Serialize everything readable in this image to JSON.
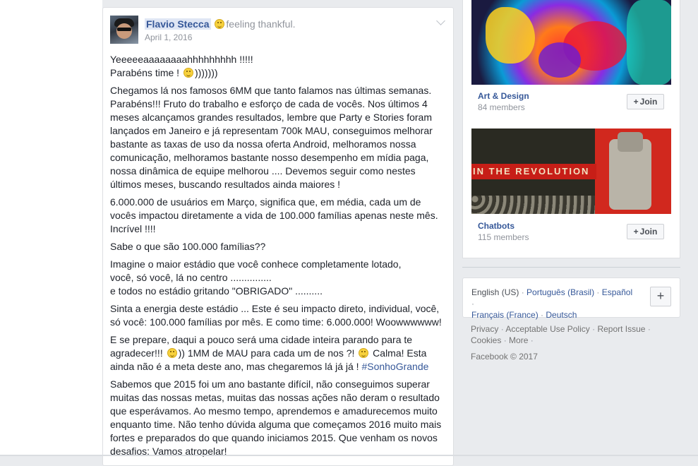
{
  "post": {
    "author": "Flavio Stecca",
    "feeling": "feeling thankful.",
    "date": "April 1, 2016",
    "paragraphs": [
      "Yeeeeeaaaaaaaahhhhhhhhh !!!!!",
      "Chegamos lá nos famosos 6MM que tanto falamos nas últimas semanas. Parabéns!!! Fruto do trabalho e esforço de cada de vocês. Nos últimos 4 meses alcançamos grandes resultados, lembre que Party e Stories foram lançados em Janeiro e já representam 700k MAU, conseguimos melhorar bastante as taxas de uso da nossa oferta Android, melhoramos nossa comunicação, melhoramos bastante nosso desempenho em mídia paga, nossa dinâmica de equipe melhorou .... Devemos seguir como nestes últimos meses, buscando resultados ainda maiores !",
      "6.000.000 de usuários em Março, significa que, em média, cada um de vocês impactou diretamente a vida de 100.000 famílias apenas neste mês. Incrível !!!!",
      "Sabe o que são 100.000 famílias??",
      "Sinta a energia deste estádio ... Este é seu impacto direto, individual, você, só você: 100.000 famílias por mês. E como time: 6.000.000! Woowwwwww!",
      "Sabemos que 2015 foi um ano bastante difícil, não conseguimos superar muitas das nossas metas, muitas das nossas ações não deram o resultado que esperávamos. Ao mesmo tempo, aprendemos e amadurecemos muito enquanto time. Não tenho dúvida alguma que começamos 2016 muito mais fortes e preparados do que quando iniciamos 2015. Que venham os novos desafios: Vamos atropelar!"
    ],
    "line_parabens_pre": "Parabéns time ! ",
    "line_parabens_post": ")))))))",
    "stadium_lines": [
      "Imagine o maior estádio que você conhece completamente lotado,",
      "você, só você, lá no centro ...............",
      "e todos no estádio gritando \"OBRIGADO\" .........."
    ],
    "prepare_1": "E se prepare, daqui a pouco será uma cidade inteira parando para te agradecer!!! ",
    "prepare_2": ")) 1MM de MAU para cada um de nos ?! ",
    "prepare_3": " Calma! Esta ainda não é a meta deste ano, mas chegaremos lá já já ! ",
    "hashtag": "#SonhoGrande"
  },
  "groups": [
    {
      "name": "Art & Design",
      "members": "84 members",
      "join_label": "Join"
    },
    {
      "name": "Chatbots",
      "members": "115 members",
      "join_label": "Join"
    }
  ],
  "group2_banner": "IN THE REVOLUTION",
  "languages": {
    "current": "English (US)",
    "others": [
      "Português (Brasil)",
      "Español",
      "Français (France)",
      "Deutsch"
    ],
    "add_label": "+"
  },
  "footer": {
    "links": [
      "Privacy",
      "Acceptable Use Policy",
      "Report Issue",
      "Cookies",
      "More"
    ],
    "copyright": "Facebook © 2017"
  },
  "icons": {
    "emoji": "smiley-emoji-icon",
    "chevron": "chevron-down-icon",
    "join": "plus-icon"
  },
  "colors": {
    "link": "#365899",
    "background": "#e9ebee",
    "muted": "#90949c"
  }
}
